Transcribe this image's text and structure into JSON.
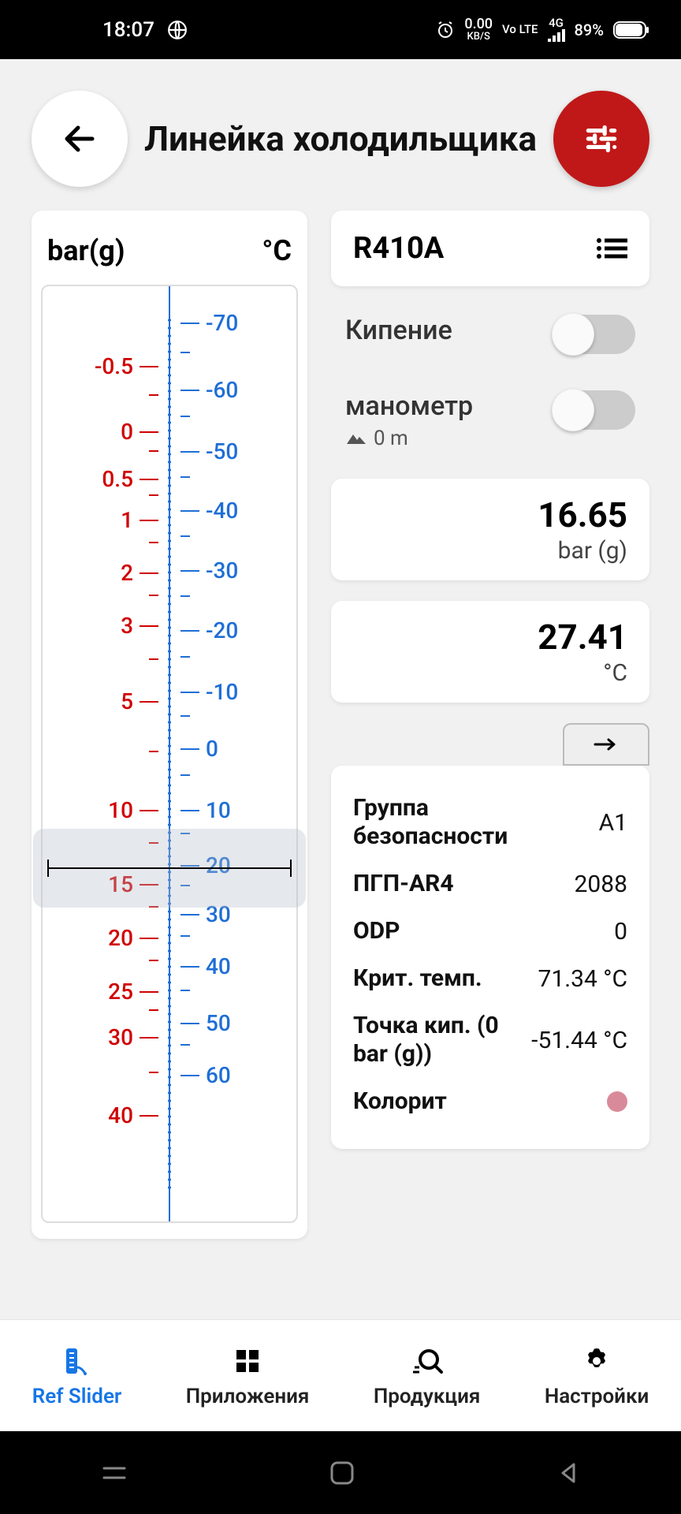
{
  "status": {
    "time": "18:07",
    "data_rate": "0.00",
    "data_unit": "KB/S",
    "volte": "Vo LTE",
    "net": "4G",
    "battery": "89%"
  },
  "header": {
    "title": "Линейка холодильщика"
  },
  "scale": {
    "left_unit": "bar(g)",
    "right_unit": "°C",
    "left_ticks": [
      "-0.5",
      "0",
      "0.5",
      "1",
      "2",
      "3",
      "5",
      "10",
      "15",
      "20",
      "25",
      "30",
      "40"
    ],
    "right_ticks": [
      "-70",
      "-60",
      "-50",
      "-40",
      "-30",
      "-20",
      "-10",
      "0",
      "10",
      "20",
      "30",
      "40",
      "50",
      "60"
    ]
  },
  "refrigerant": "R410A",
  "toggles": {
    "boiling": {
      "label": "Кипение"
    },
    "gauge": {
      "label": "манометр",
      "altitude": "0 m"
    }
  },
  "pressure": {
    "value": "16.65",
    "unit": "bar (g)"
  },
  "temperature": {
    "value": "27.41",
    "unit": "°C"
  },
  "props": {
    "group_label": "Группа безопасности",
    "group_value": "A1",
    "gwp_label": "ПГП-AR4",
    "gwp_value": "2088",
    "odp_label": "ODP",
    "odp_value": "0",
    "crit_label": "Крит. темп.",
    "crit_value": "71.34 °C",
    "boil_label": "Точка кип. (0 bar (g))",
    "boil_value": "-51.44 °C",
    "color_label": "Колорит"
  },
  "tabs": {
    "slider": "Ref Slider",
    "apps": "Приложения",
    "products": "Продукция",
    "settings": "Настройки"
  }
}
